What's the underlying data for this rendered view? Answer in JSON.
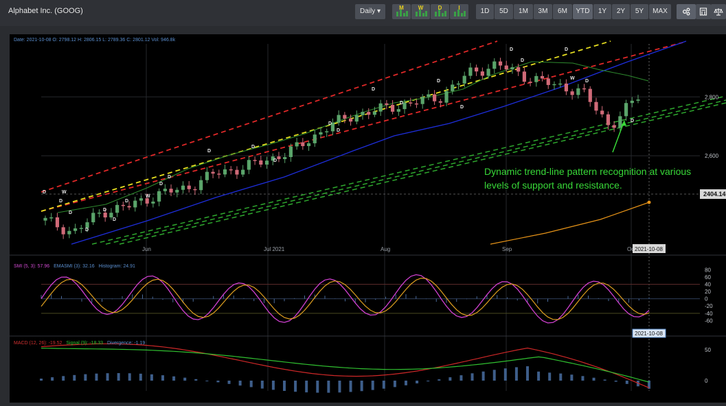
{
  "header": {
    "title": "Alphabet Inc. (GOOG)",
    "interval_label": "Daily ▾",
    "indicator_buttons": [
      "M",
      "W",
      "D",
      "I"
    ],
    "ranges": [
      "1D",
      "5D",
      "1M",
      "3M",
      "6M",
      "YTD",
      "1Y",
      "2Y",
      "5Y",
      "MAX"
    ],
    "active_range": "YTD",
    "tool_icons": [
      "settings-icon",
      "calculator-icon",
      "scale-icon"
    ]
  },
  "price_panel": {
    "ohlc_label": "Date: 2021-10-08 O: 2798.12 H: 2806.15 L: 2789.36 C: 2801.12 Vol: 946.8k",
    "last_price_label": "2404.14",
    "cursor_date_label": "2021-10-08",
    "annotation_line1": "Dynamic trend-line pattern recognition at various",
    "annotation_line2": "levels of support and resistance."
  },
  "smi_panel": {
    "label_smi": "SMI (5, 3): 57.96",
    "label_ema": "EMASMI (3): 32.16",
    "label_hist": "Histogram: 24.91",
    "cursor_date_label": "2021-10-08"
  },
  "macd_panel": {
    "label_macd": "MACD (12, 26): -19.52",
    "label_signal": "Signal (9): -18.33",
    "label_div": "Divergence: -1.19"
  },
  "colors": {
    "background": "#000000",
    "up_candle": "#5aa46a",
    "down_candle": "#d06a78",
    "resistance": "#e02828",
    "support": "#2ea82e",
    "midline": "#e8e020",
    "ma_fast": "#1e2edc",
    "ma_long": "#e89418",
    "smi": "#d040d0",
    "ema": "#e0a020",
    "annotation": "#38d838"
  },
  "chart_data": [
    {
      "type": "candlestick",
      "x_tick_labels": [
        "Jun",
        "Jul 2021",
        "Aug",
        "Sep",
        "Oct 2021"
      ],
      "y_tick_labels": [
        "2,600",
        "2,800"
      ],
      "ylim": [
        2300,
        2980
      ],
      "grid": true,
      "approx_close_path": [
        [
          "2021-05-14",
          2380
        ],
        [
          "2021-05-21",
          2340
        ],
        [
          "2021-05-28",
          2410
        ],
        [
          "2021-06-04",
          2430
        ],
        [
          "2021-06-11",
          2470
        ],
        [
          "2021-06-18",
          2490
        ],
        [
          "2021-06-25",
          2540
        ],
        [
          "2021-07-02",
          2560
        ],
        [
          "2021-07-09",
          2590
        ],
        [
          "2021-07-16",
          2630
        ],
        [
          "2021-07-23",
          2700
        ],
        [
          "2021-07-30",
          2740
        ],
        [
          "2021-08-06",
          2760
        ],
        [
          "2021-08-13",
          2780
        ],
        [
          "2021-08-20",
          2800
        ],
        [
          "2021-08-27",
          2880
        ],
        [
          "2021-09-03",
          2910
        ],
        [
          "2021-09-10",
          2870
        ],
        [
          "2021-09-17",
          2840
        ],
        [
          "2021-09-24",
          2820
        ],
        [
          "2021-10-01",
          2700
        ],
        [
          "2021-10-08",
          2801
        ]
      ]
    },
    {
      "type": "line",
      "series": [
        {
          "name": "SMI",
          "value": 57.96
        },
        {
          "name": "EMASMI",
          "value": 32.16
        }
      ],
      "y_tick_labels": [
        "80",
        "60",
        "40",
        "20",
        "0",
        "-20",
        "-40",
        "-60"
      ],
      "ylim": [
        -80,
        90
      ]
    },
    {
      "type": "line",
      "series": [
        {
          "name": "MACD",
          "value": -19.52
        },
        {
          "name": "Signal",
          "value": -18.33
        }
      ],
      "y_tick_labels": [
        "50",
        "0"
      ]
    }
  ]
}
